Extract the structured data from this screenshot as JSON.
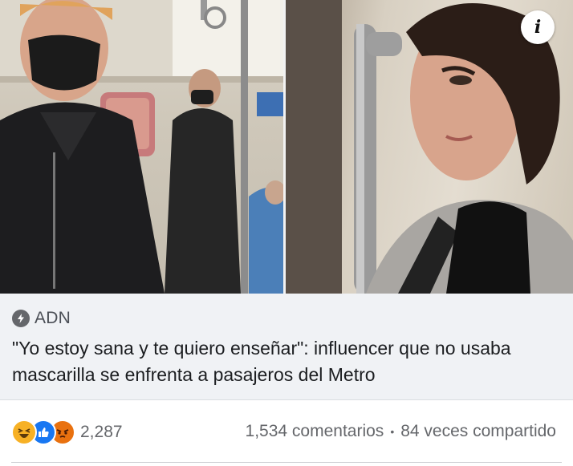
{
  "post": {
    "source": "ADN",
    "headline": "\"Yo estoy sana y te quiero enseñar\": influencer que no usaba mascarilla se enfrenta a pasajeros del Metro",
    "info_button_label": "i"
  },
  "reactions": {
    "icons": [
      "haha-icon",
      "like-icon",
      "angry-icon"
    ],
    "count": "2,287"
  },
  "stats": {
    "comments": "1,534 comentarios",
    "separator": "•",
    "shares": "84 veces compartido"
  },
  "colors": {
    "card_bg": "#f0f2f5",
    "secondary_text": "#65676b",
    "like_blue": "#1877f2",
    "haha_yellow": "#f7b125",
    "angry_orange": "#e9710f"
  }
}
